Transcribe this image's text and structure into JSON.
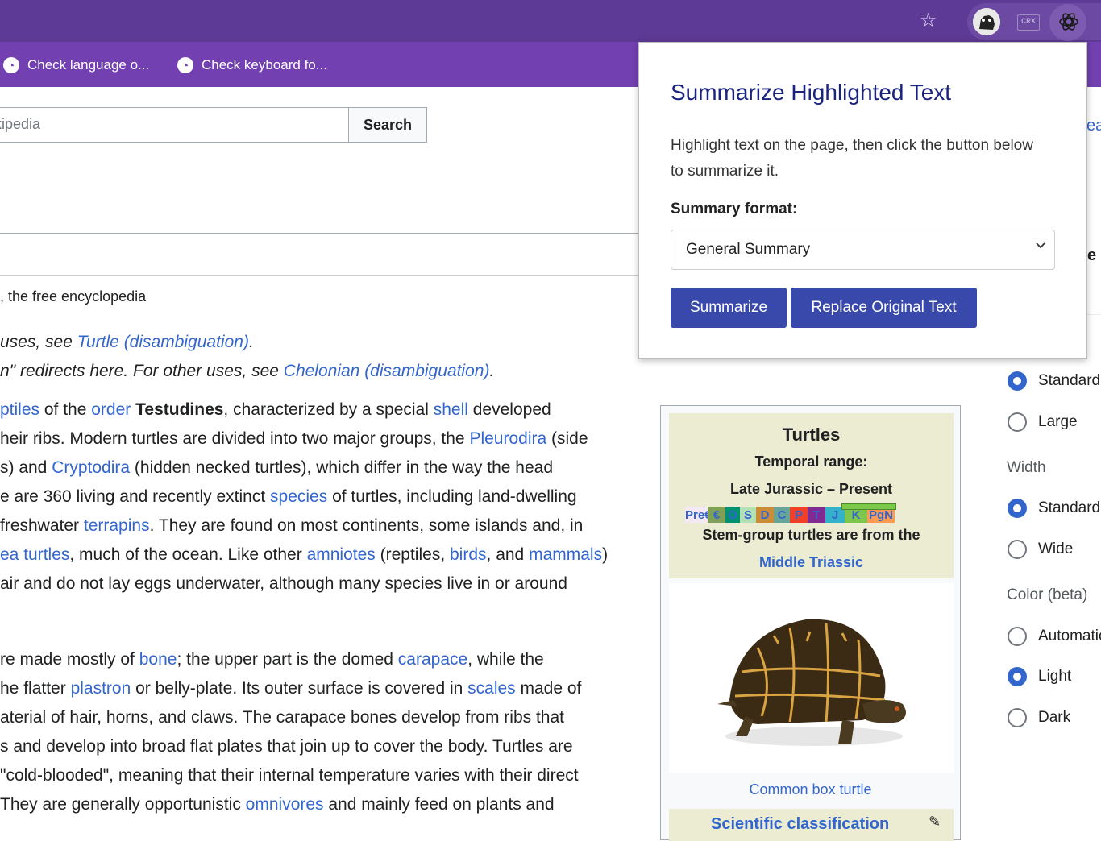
{
  "toolbar": {
    "bookmark_star": "☆",
    "ext_crx": "CRX"
  },
  "bookmarks": [
    {
      "label": "Check language o..."
    },
    {
      "label": "Check keyboard fo..."
    }
  ],
  "search": {
    "placeholder": "ikipedia",
    "button_label": "Search"
  },
  "article": {
    "tagline": ", the free encyclopedia",
    "hatnote1": {
      "pre": "uses, see ",
      "link": "Turtle (disambiguation)",
      "post": "."
    },
    "hatnote2": {
      "pre": "n\" redirects here. For other uses, see ",
      "link": "Chelonian (disambiguation)",
      "post": "."
    },
    "p1": [
      [
        {
          "t": "ptiles",
          "l": true
        },
        {
          "t": " of the "
        },
        {
          "t": "order",
          "l": true
        },
        {
          "t": " "
        },
        {
          "t": "Testudines",
          "b": true
        },
        {
          "t": ", characterized by a special "
        },
        {
          "t": "shell",
          "l": true
        },
        {
          "t": " developed"
        }
      ],
      [
        {
          "t": "heir ribs. Modern turtles are divided into two major groups, the "
        },
        {
          "t": "Pleurodira",
          "l": true
        },
        {
          "t": " (side"
        }
      ],
      [
        {
          "t": "s) and "
        },
        {
          "t": "Cryptodira",
          "l": true
        },
        {
          "t": " (hidden necked turtles), which differ in the way the head"
        }
      ],
      [
        {
          "t": "e are 360 living and recently extinct "
        },
        {
          "t": "species",
          "l": true
        },
        {
          "t": " of turtles, including land-dwelling"
        }
      ],
      [
        {
          "t": "freshwater "
        },
        {
          "t": "terrapins",
          "l": true
        },
        {
          "t": ". They are found on most continents, some islands and, in"
        }
      ],
      [
        {
          "t": "ea turtles",
          "l": true
        },
        {
          "t": ", much of the ocean. Like other "
        },
        {
          "t": "amniotes",
          "l": true
        },
        {
          "t": " (reptiles, "
        },
        {
          "t": "birds",
          "l": true
        },
        {
          "t": ", and "
        },
        {
          "t": "mammals",
          "l": true
        },
        {
          "t": ")"
        }
      ],
      [
        {
          "t": "air and do not lay eggs underwater, although many species live in or around"
        }
      ]
    ],
    "p2": [
      [
        {
          "t": "re made mostly of "
        },
        {
          "t": "bone",
          "l": true
        },
        {
          "t": "; the upper part is the domed "
        },
        {
          "t": "carapace",
          "l": true
        },
        {
          "t": ", while the"
        }
      ],
      [
        {
          "t": "he flatter "
        },
        {
          "t": "plastron",
          "l": true
        },
        {
          "t": " or belly-plate. Its outer surface is covered in "
        },
        {
          "t": "scales",
          "l": true
        },
        {
          "t": " made of"
        }
      ],
      [
        {
          "t": "aterial of hair, horns, and claws. The carapace bones develop from ribs that"
        }
      ],
      [
        {
          "t": "s and develop into broad flat plates that join up to cover the body. Turtles are"
        }
      ],
      [
        {
          "t": " \"cold-blooded\", meaning that their internal temperature varies with their direct"
        }
      ],
      [
        {
          "t": "They are generally opportunistic "
        },
        {
          "t": "omnivores",
          "l": true
        },
        {
          "t": " and mainly feed on plants and"
        }
      ]
    ]
  },
  "infobox": {
    "title": "Turtles",
    "temporal_label": "Temporal range:",
    "temporal_value": "Late Jurassic – Present",
    "timeline": [
      {
        "label": "Pre€",
        "color": "#f5e8f5"
      },
      {
        "label": "€",
        "color": "#7fa056"
      },
      {
        "label": "O",
        "color": "#009270"
      },
      {
        "label": "S",
        "color": "#b3e1b6"
      },
      {
        "label": "D",
        "color": "#cb8c37"
      },
      {
        "label": "C",
        "color": "#67a599"
      },
      {
        "label": "P",
        "color": "#f04028"
      },
      {
        "label": "T",
        "color": "#812b92"
      },
      {
        "label": "J",
        "color": "#34b2c9"
      },
      {
        "label": "K",
        "color": "#7fc64e"
      },
      {
        "label": "PgN",
        "color": "#fd9a52"
      }
    ],
    "note": "Stem-group turtles are from the",
    "note_link": "Middle Triassic",
    "caption": "Common box turtle",
    "sci_header": "Scientific classification"
  },
  "sidebar": {
    "clip_top": "ea",
    "clip_mid": "e",
    "text_size_options": [
      {
        "label": "Standard",
        "checked": true
      },
      {
        "label": "Large",
        "checked": false
      }
    ],
    "width_label": "Width",
    "width_options": [
      {
        "label": "Standard",
        "checked": true
      },
      {
        "label": "Wide",
        "checked": false
      }
    ],
    "color_label": "Color (beta)",
    "color_options": [
      {
        "label": "Automatic",
        "checked": false
      },
      {
        "label": "Light",
        "checked": true
      },
      {
        "label": "Dark",
        "checked": false
      }
    ]
  },
  "popup": {
    "title": "Summarize Highlighted Text",
    "description": "Highlight text on the page, then click the button below to summarize it.",
    "format_label": "Summary format:",
    "format_value": "General Summary",
    "summarize_button": "Summarize",
    "replace_button": "Replace Original Text"
  },
  "colors": {
    "chrome": "#5d3a95",
    "bookmarks_bar": "#7240b0",
    "link": "#3366cc",
    "popup_button": "#3949ab",
    "popup_title": "#1a237e",
    "infobox_header": "#ececd2"
  }
}
